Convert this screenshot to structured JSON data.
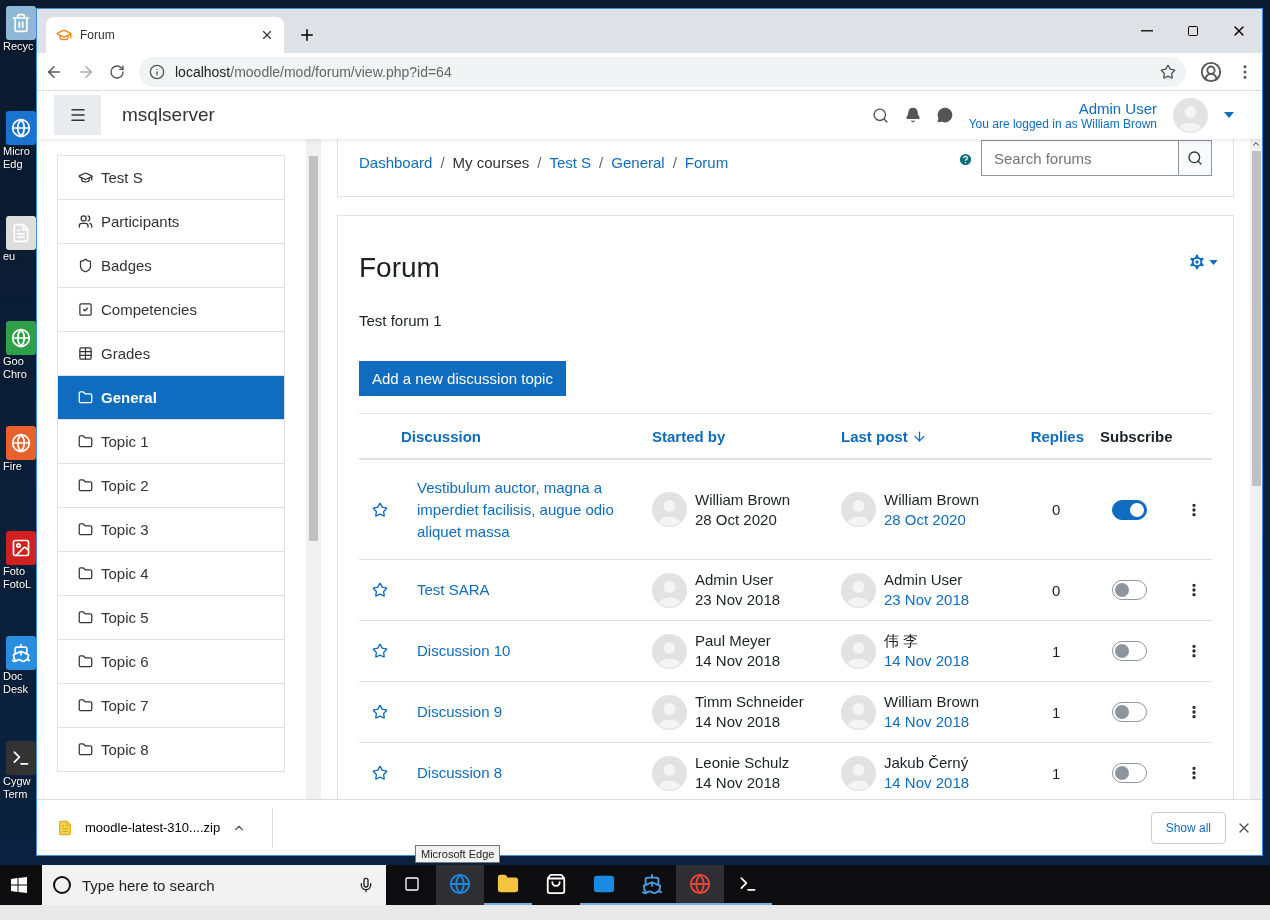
{
  "desktop_icons": [
    {
      "kind": "recycle",
      "lines": [
        "Recyc"
      ]
    },
    {
      "kind": "edge",
      "lines": [
        "Micro",
        "Edg"
      ]
    },
    {
      "kind": "doc",
      "lines": [
        "eu"
      ]
    },
    {
      "kind": "chrome",
      "lines": [
        "Goo",
        "Chro"
      ]
    },
    {
      "kind": "firefox",
      "lines": [
        "Fire"
      ]
    },
    {
      "kind": "foto",
      "lines": [
        "Foto",
        "FotoL"
      ]
    },
    {
      "kind": "docker",
      "lines": [
        "Doc",
        "Desk"
      ]
    },
    {
      "kind": "terminal",
      "lines": [
        "Cygw",
        "Term"
      ]
    }
  ],
  "browser": {
    "tab_title": "Forum",
    "url_host": "localhost",
    "url_path": "/moodle/mod/forum/view.php?id=64"
  },
  "navbar": {
    "site_name": "msqlserver",
    "user_name": "Admin User",
    "logged_in_as": "You are logged in as William Brown"
  },
  "sidebar": {
    "items": [
      {
        "label": "Test S",
        "kind": "course",
        "selected": false
      },
      {
        "label": "Participants",
        "kind": "users",
        "selected": false
      },
      {
        "label": "Badges",
        "kind": "badge",
        "selected": false
      },
      {
        "label": "Competencies",
        "kind": "check",
        "selected": false
      },
      {
        "label": "Grades",
        "kind": "table",
        "selected": false
      },
      {
        "label": "General",
        "kind": "folder",
        "selected": true
      },
      {
        "label": "Topic 1",
        "kind": "folder",
        "selected": false
      },
      {
        "label": "Topic 2",
        "kind": "folder",
        "selected": false
      },
      {
        "label": "Topic 3",
        "kind": "folder",
        "selected": false
      },
      {
        "label": "Topic 4",
        "kind": "folder",
        "selected": false
      },
      {
        "label": "Topic 5",
        "kind": "folder",
        "selected": false
      },
      {
        "label": "Topic 6",
        "kind": "folder",
        "selected": false
      },
      {
        "label": "Topic 7",
        "kind": "folder",
        "selected": false
      },
      {
        "label": "Topic 8",
        "kind": "folder",
        "selected": false
      }
    ]
  },
  "breadcrumb_separator": "/",
  "breadcrumb": [
    {
      "label": "Dashboard",
      "link": true
    },
    {
      "label": "My courses",
      "link": false
    },
    {
      "label": "Test S",
      "link": true
    },
    {
      "label": "General",
      "link": true
    },
    {
      "label": "Forum",
      "link": true
    }
  ],
  "search": {
    "placeholder": "Search forums"
  },
  "forum": {
    "title": "Forum",
    "description": "Test forum 1",
    "add_button": "Add a new discussion topic"
  },
  "table": {
    "columns": [
      {
        "label": "Discussion",
        "link": true,
        "sorted": false
      },
      {
        "label": "Started by",
        "link": true,
        "sorted": false
      },
      {
        "label": "Last post",
        "link": true,
        "sorted": true
      },
      {
        "label": "Replies",
        "link": true,
        "sorted": false
      },
      {
        "label": "Subscribe",
        "link": false,
        "sorted": false
      }
    ],
    "rows": [
      {
        "title": "Vestibulum auctor, magna a imperdiet facilisis, augue odio aliquet massa",
        "starter": "William Brown",
        "started": "28 Oct 2020",
        "last_user": "William Brown",
        "last_date": "28 Oct 2020",
        "replies": "0",
        "subscribed": true
      },
      {
        "title": "Test SARA",
        "starter": "Admin User",
        "started": "23 Nov 2018",
        "last_user": "Admin User",
        "last_date": "23 Nov 2018",
        "replies": "0",
        "subscribed": false
      },
      {
        "title": "Discussion 10",
        "starter": "Paul Meyer",
        "started": "14 Nov 2018",
        "last_user": "伟 李",
        "last_date": "14 Nov 2018",
        "replies": "1",
        "subscribed": false
      },
      {
        "title": "Discussion 9",
        "starter": "Timm Schneider",
        "started": "14 Nov 2018",
        "last_user": "William Brown",
        "last_date": "14 Nov 2018",
        "replies": "1",
        "subscribed": false
      },
      {
        "title": "Discussion 8",
        "starter": "Leonie Schulz",
        "started": "14 Nov 2018",
        "last_user": "Jakub Černý",
        "last_date": "14 Nov 2018",
        "replies": "1",
        "subscribed": false
      }
    ]
  },
  "downloads": {
    "file": "moodle-latest-310....zip",
    "show_all": "Show all"
  },
  "taskbar": {
    "search_placeholder": "Type here to search",
    "tooltip": "Microsoft Edge"
  }
}
